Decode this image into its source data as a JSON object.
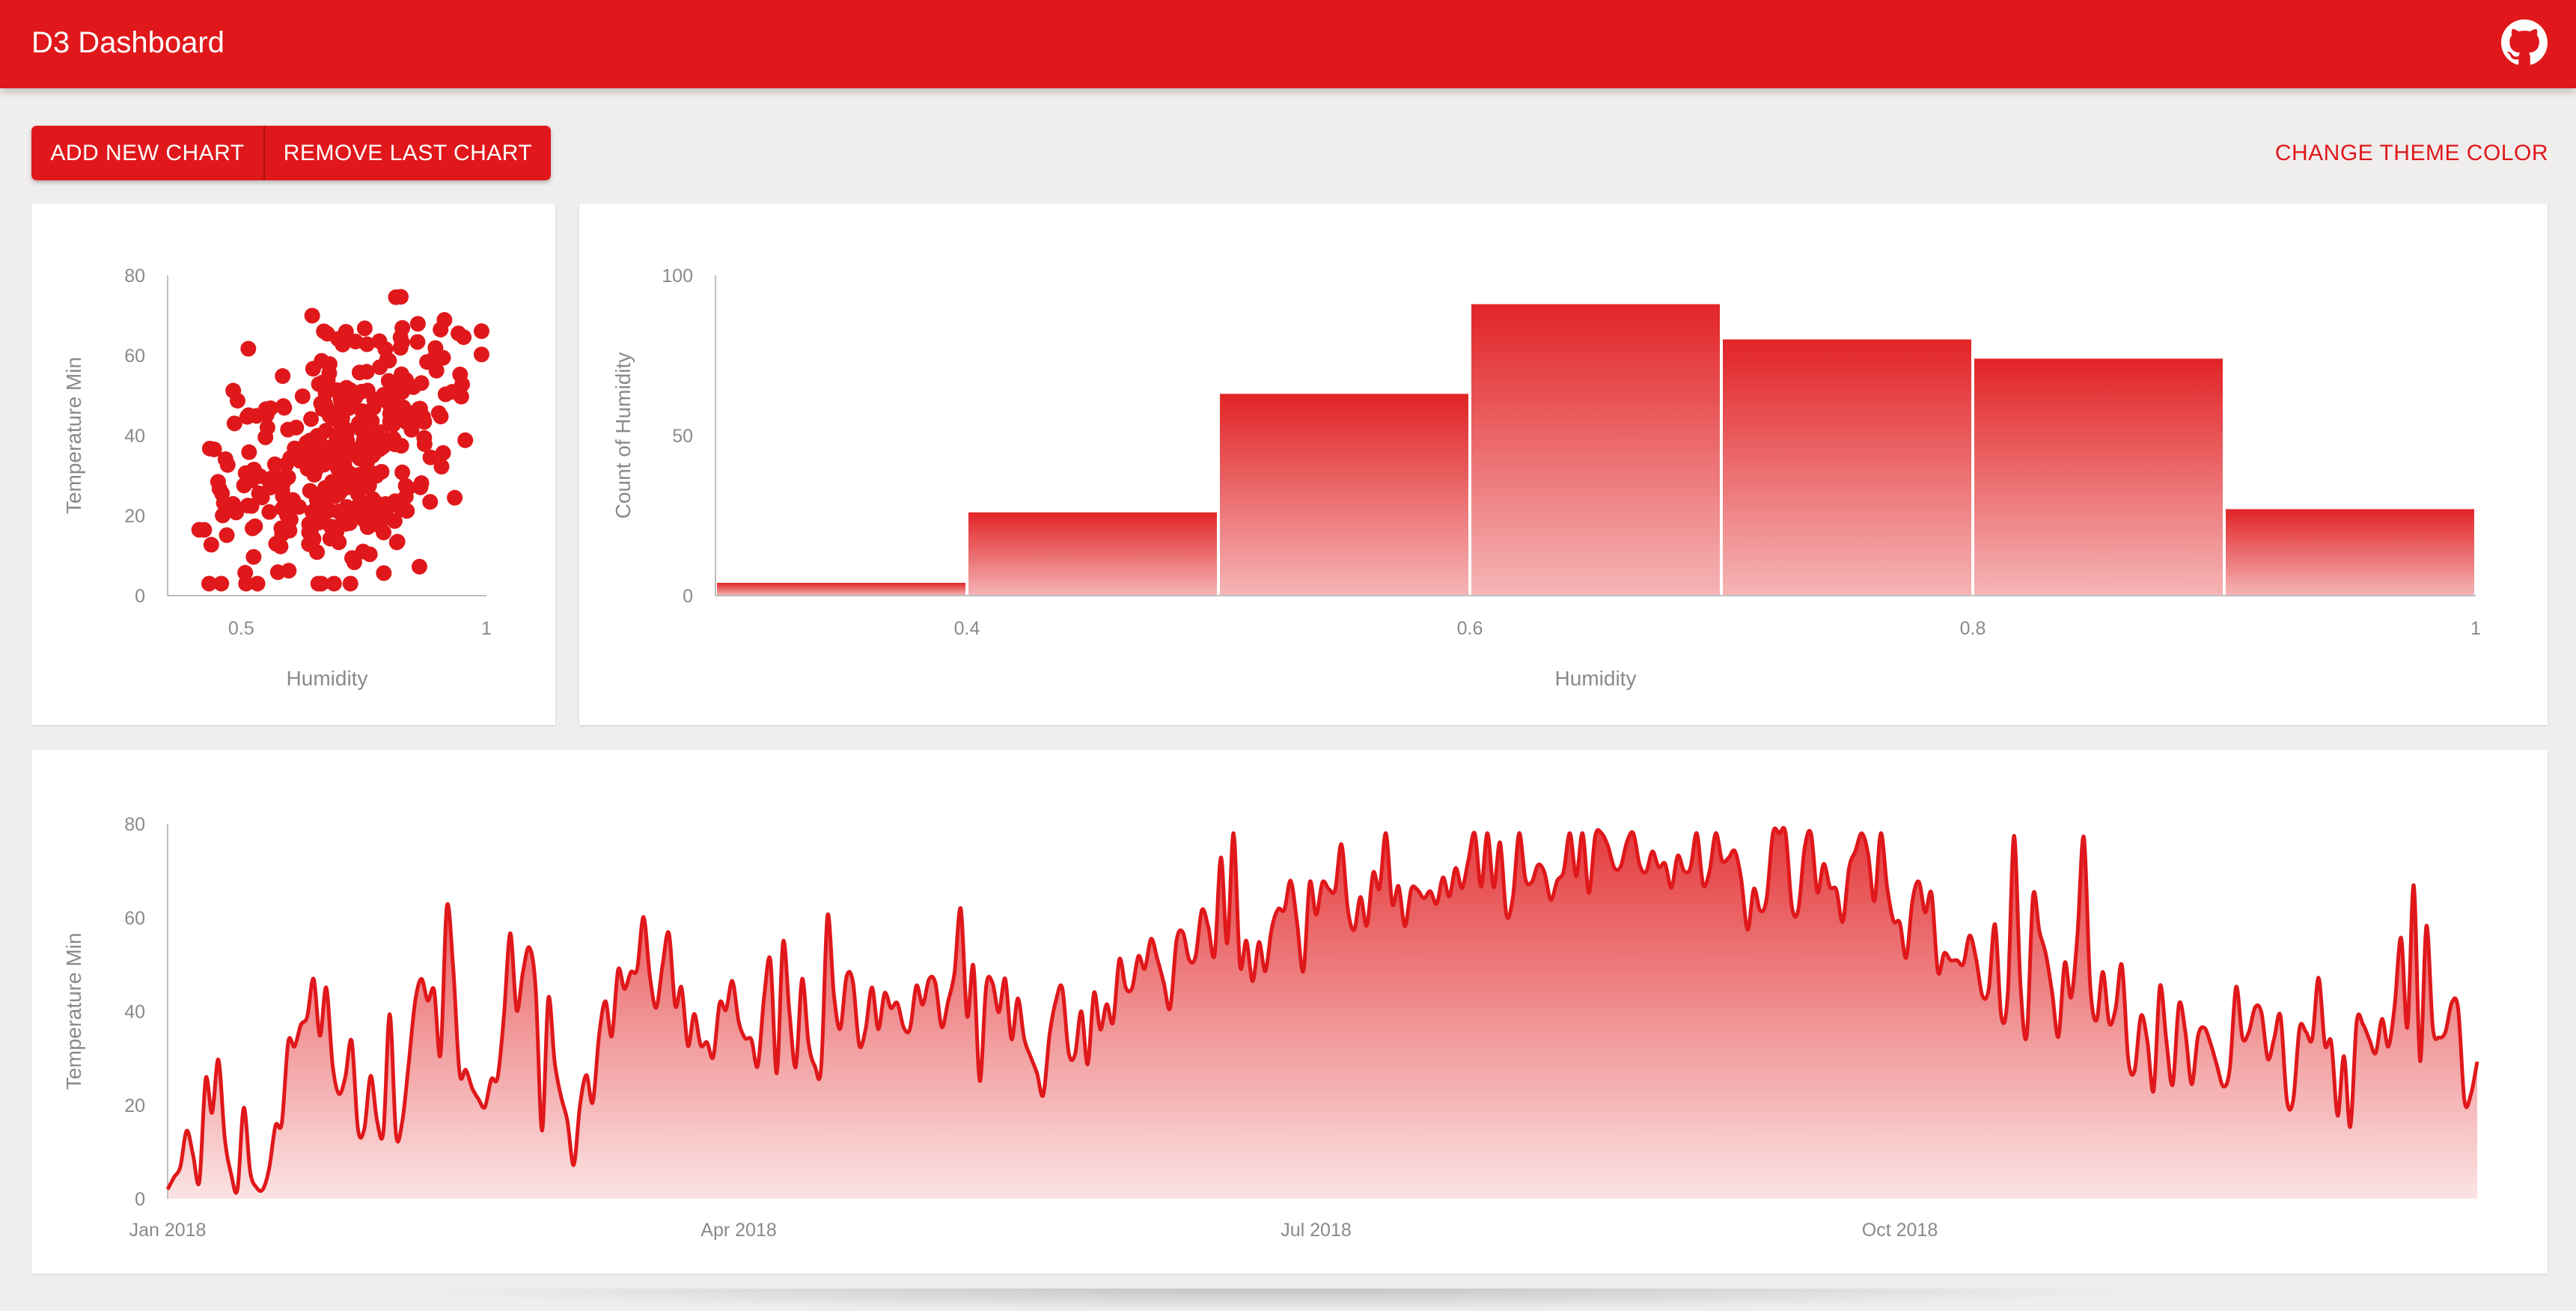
{
  "app": {
    "title": "D3 Dashboard"
  },
  "toolbar": {
    "add_label": "ADD NEW CHART",
    "remove_label": "REMOVE LAST CHART",
    "theme_label": "CHANGE THEME COLOR"
  },
  "theme": {
    "accent": "#e0181b",
    "background": "#f0eeed",
    "card": "#ffffff",
    "axis_text": "#8a8a8a"
  },
  "icons": {
    "github": "github-icon"
  },
  "chart_data": [
    {
      "type": "scatter",
      "xlabel": "Humidity",
      "ylabel": "Temperature Min",
      "xlim": [
        0.35,
        1.0
      ],
      "ylim": [
        0,
        80
      ],
      "x_ticks": [
        "0.5",
        "1"
      ],
      "y_ticks": [
        "0",
        "20",
        "40",
        "60",
        "80"
      ],
      "n_points": 365,
      "seed": 7
    },
    {
      "type": "bar",
      "xlabel": "Humidity",
      "ylabel": "Count of Humidity",
      "bin_edges": [
        0.3,
        0.4,
        0.5,
        0.6,
        0.7,
        0.8,
        0.9,
        1.0
      ],
      "values": [
        4,
        26,
        63,
        91,
        80,
        74,
        27
      ],
      "ylim": [
        0,
        100
      ],
      "x_ticks": [
        "0.4",
        "0.6",
        "0.8",
        "1"
      ],
      "y_ticks": [
        "0",
        "50",
        "100"
      ]
    },
    {
      "type": "area",
      "xlabel": "",
      "ylabel": "Temperature Min",
      "x_start": "2018-01-01",
      "x_end": "2018-12-31",
      "ylim": [
        0,
        80
      ],
      "x_ticks": [
        "Jan 2018",
        "Apr 2018",
        "Jul 2018",
        "Oct 2018"
      ],
      "y_ticks": [
        "0",
        "20",
        "40",
        "60",
        "80"
      ],
      "anchors": [
        [
          "2018-01-01",
          6
        ],
        [
          "2018-01-08",
          20
        ],
        [
          "2018-01-16",
          4
        ],
        [
          "2018-01-24",
          43
        ],
        [
          "2018-02-01",
          16
        ],
        [
          "2018-02-12",
          38
        ],
        [
          "2018-02-20",
          20
        ],
        [
          "2018-02-27",
          42
        ],
        [
          "2018-03-05",
          15
        ],
        [
          "2018-03-15",
          43
        ],
        [
          "2018-03-25",
          40
        ],
        [
          "2018-04-05",
          33
        ],
        [
          "2018-04-15",
          32
        ],
        [
          "2018-04-25",
          36
        ],
        [
          "2018-05-05",
          45
        ],
        [
          "2018-05-15",
          32
        ],
        [
          "2018-05-25",
          35
        ],
        [
          "2018-06-01",
          47
        ],
        [
          "2018-06-12",
          55
        ],
        [
          "2018-06-22",
          55
        ],
        [
          "2018-07-01",
          63
        ],
        [
          "2018-07-10",
          66
        ],
        [
          "2018-07-20",
          67
        ],
        [
          "2018-08-01",
          71
        ],
        [
          "2018-08-10",
          71
        ],
        [
          "2018-08-20",
          73
        ],
        [
          "2018-09-01",
          71
        ],
        [
          "2018-09-10",
          66
        ],
        [
          "2018-09-20",
          66
        ],
        [
          "2018-10-01",
          61
        ],
        [
          "2018-10-10",
          52
        ],
        [
          "2018-10-20",
          44
        ],
        [
          "2018-11-01",
          42
        ],
        [
          "2018-11-10",
          35
        ],
        [
          "2018-11-20",
          34
        ],
        [
          "2018-12-01",
          30
        ],
        [
          "2018-12-10",
          33
        ],
        [
          "2018-12-20",
          37
        ],
        [
          "2018-12-31",
          31
        ]
      ],
      "spikes": [
        [
          "2018-01-21",
          10
        ],
        [
          "2018-02-26",
          6
        ],
        [
          "2018-03-10",
          10
        ],
        [
          "2018-03-18",
          12
        ],
        [
          "2018-04-27",
          8
        ],
        [
          "2018-05-22",
          10
        ],
        [
          "2018-06-18",
          12
        ],
        [
          "2018-07-16",
          7
        ],
        [
          "2018-08-13",
          6
        ],
        [
          "2018-09-03",
          5
        ],
        [
          "2018-10-30",
          22
        ],
        [
          "2018-11-16",
          -18
        ]
      ],
      "seed": 11
    }
  ]
}
